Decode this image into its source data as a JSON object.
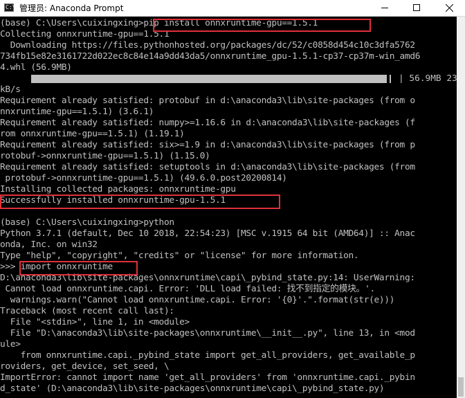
{
  "window": {
    "title": "管理员: Anaconda Prompt",
    "icon": "console-icon"
  },
  "console": {
    "lines": [
      "(base) C:\\Users\\cuixingxing>pip install onnxruntime-gpu==1.5.1",
      "Collecting onnxruntime-gpu==1.5.1",
      "  Downloading https://files.pythonhosted.org/packages/dc/52/c0858d454c10c3dfa5762",
      "734fb15e82e3161722d022ec8c84e14a9dd43da5/onnxruntime_gpu-1.5.1-cp37-cp37m-win_amd6",
      "4.whl (56.9MB)",
      "",
      "kB/s",
      "Requirement already satisfied: protobuf in d:\\anaconda3\\lib\\site-packages (from o",
      "nnxruntime-gpu==1.5.1) (3.6.1)",
      "Requirement already satisfied: numpy>=1.16.6 in d:\\anaconda3\\lib\\site-packages (f",
      "rom onnxruntime-gpu==1.5.1) (1.19.1)",
      "Requirement already satisfied: six>=1.9 in d:\\anaconda3\\lib\\site-packages (from p",
      "rotobuf->onnxruntime-gpu==1.5.1) (1.15.0)",
      "Requirement already satisfied: setuptools in d:\\anaconda3\\lib\\site-packages (from",
      " protobuf->onnxruntime-gpu==1.5.1) (49.6.0.post20200814)",
      "Installing collected packages: onnxruntime-gpu",
      "Successfully installed onnxruntime-gpu-1.5.1",
      "",
      "(base) C:\\Users\\cuixingxing>python",
      "Python 3.7.1 (default, Dec 10 2018, 22:54:23) [MSC v.1915 64 bit (AMD64)] :: Anac",
      "onda, Inc. on win32",
      "Type \"help\", \"copyright\", \"credits\" or \"license\" for more information.",
      ">>> import onnxruntime",
      "D:\\anaconda3\\lib\\site-packages\\onnxruntime\\capi\\_pybind_state.py:14: UserWarning:",
      " Cannot load onnxruntime.capi. Error: 'DLL load failed: 找不到指定的模块。'.",
      "  warnings.warn(\"Cannot load onnxruntime.capi. Error: '{0}'.\".format(str(e)))",
      "Traceback (most recent call last):",
      "  File \"<stdin>\", line 1, in <module>",
      "  File \"D:\\anaconda3\\lib\\site-packages\\onnxruntime\\__init__.py\", line 13, in <mod",
      "ule>",
      "    from onnxruntime.capi._pybind_state import get_all_providers, get_available_p",
      "roviders, get_device, set_seed, \\",
      "ImportError: cannot import name 'get_all_providers' from 'onnxruntime.capi._pybin",
      "d_state' (D:\\anaconda3\\lib\\site-packages\\onnxruntime\\capi\\_pybind_state.py)"
    ],
    "progress": {
      "fraction": 1.0,
      "text": "| 56.9MB 23"
    }
  },
  "colors": {
    "text": "#c0c0c0",
    "background": "#000000",
    "highlight_box": "#e0303a"
  }
}
